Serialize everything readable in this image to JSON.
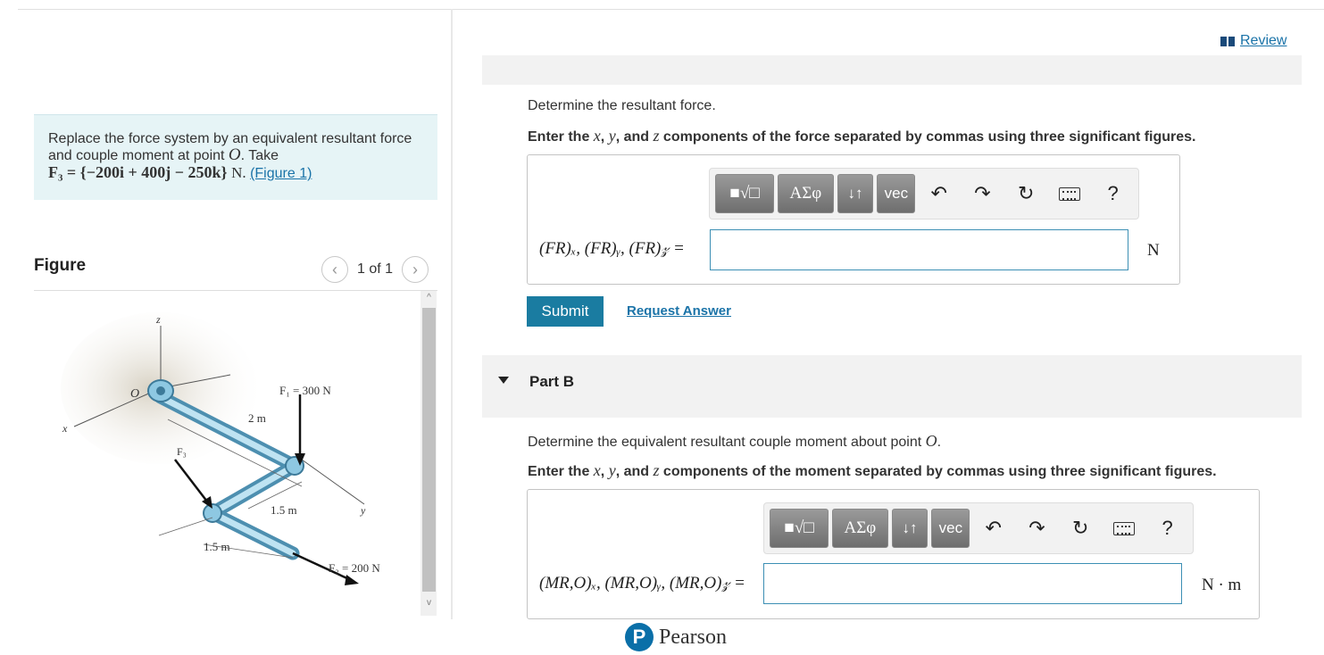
{
  "problem": {
    "line1": "Replace the force system by an equivalent resultant force",
    "line2_prefix": "and couple moment at point ",
    "point": "O",
    "line2_suffix": ". Take",
    "equation": "F₃ = {−200i + 400j − 250k}",
    "equation_unit": "N.",
    "figure_link": "(Figure 1)"
  },
  "figure_panel": {
    "title": "Figure",
    "pager_text": "1 of 1",
    "labels": {
      "z": "z",
      "x": "x",
      "y": "y",
      "o": "O",
      "f1": "F₁ = 300 N",
      "f2": "F₂ = 200 N",
      "f3": "F₃",
      "d1": "2 m",
      "d2": "1.5 m",
      "d3": "1.5 m"
    }
  },
  "header": {
    "review_label": "Review"
  },
  "part_a": {
    "question": "Determine the resultant force.",
    "instruction_pre": "Enter the ",
    "instruction_x": "x",
    "instruction_sep1": ", ",
    "instruction_y": "y",
    "instruction_sep2": ", and ",
    "instruction_z": "z",
    "instruction_post": " components of the force separated by commas using three significant figures.",
    "answer_label": "(FR)ₓ, (FR)ᵧ, (FR)𝓏 =",
    "unit": "N",
    "input_value": "",
    "submit_label": "Submit",
    "request_label": "Request Answer"
  },
  "part_b": {
    "title": "Part B",
    "question_pre": "Determine the equivalent resultant couple moment about point ",
    "question_point": "O",
    "question_post": ".",
    "instruction_pre": "Enter the ",
    "instruction_x": "x",
    "instruction_sep1": ", ",
    "instruction_y": "y",
    "instruction_sep2": ", and ",
    "instruction_z": "z",
    "instruction_post": " components of the moment separated by commas using three significant figures.",
    "answer_label": "(MR,O)ₓ, (MR,O)ᵧ, (MR,O)𝓏 =",
    "unit": "N · m",
    "input_value": ""
  },
  "toolbar": {
    "templates_label": "■√□",
    "greek_label": "ΑΣφ",
    "sort_label": "↓↑",
    "vec_label": "vec",
    "help_label": "?"
  },
  "footer": {
    "brand": "Pearson",
    "logo_letter": "P"
  }
}
